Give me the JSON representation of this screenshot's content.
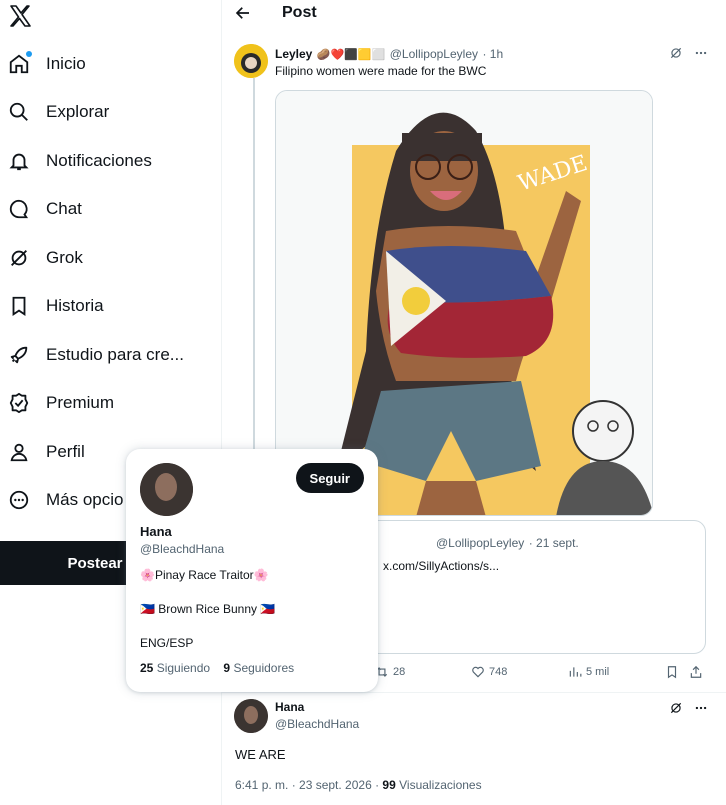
{
  "sidebar": {
    "logo": "x-logo-icon",
    "items": [
      {
        "label": "Inicio",
        "icon": "home-icon"
      },
      {
        "label": "Explorar",
        "icon": "search-icon"
      },
      {
        "label": "Notificaciones",
        "icon": "bell-icon"
      },
      {
        "label": "Chat",
        "icon": "chat-icon"
      },
      {
        "label": "Grok",
        "icon": "grok-icon"
      },
      {
        "label": "Historia",
        "icon": "bookmark-icon"
      },
      {
        "label": "Estudio para cre...",
        "icon": "rocket-icon"
      },
      {
        "label": "Premium",
        "icon": "verified-icon"
      },
      {
        "label": "Perfil",
        "icon": "person-icon"
      },
      {
        "label": "Más opcio",
        "icon": "more-circle-icon"
      }
    ],
    "post_button": "Postear"
  },
  "header": {
    "title": "Post"
  },
  "tweet": {
    "name": "Leyley",
    "name_emojis": "🥔❤️⬛🟨⬜",
    "handle": "@LollipopLeyley",
    "time": "· 1h",
    "text": "Filipino women were made for the BWC"
  },
  "media_text": "WADE",
  "quote": {
    "handle": "@LollipopLeyley",
    "time": "· 21 sept.",
    "text": "x.com/SillyActions/s..."
  },
  "actions": {
    "retweets": "28",
    "likes": "748",
    "views": "5 mil"
  },
  "reply": {
    "name": "Hana",
    "handle": "@BleachdHana",
    "text": "WE ARE",
    "time": "6:41 p. m. · 23 sept. 2026 · ",
    "views_count": "99",
    "views_label": " Visualizaciones"
  },
  "hovercard": {
    "follow_label": "Seguir",
    "name": "Hana",
    "handle": "@BleachdHana",
    "bio_line1": "Pinay Race Traitor",
    "bio_line2": "Brown Rice Bunny",
    "bio_line3": "ENG/ESP",
    "following_count": "25",
    "following_label": " Siguiendo",
    "followers_count": "9",
    "followers_label": " Seguidores"
  },
  "colors": {
    "accent": "#1d9bf0",
    "text": "#0f1419",
    "muted": "#536471",
    "border": "#cfd9de",
    "art_bg": "#f5c860"
  }
}
